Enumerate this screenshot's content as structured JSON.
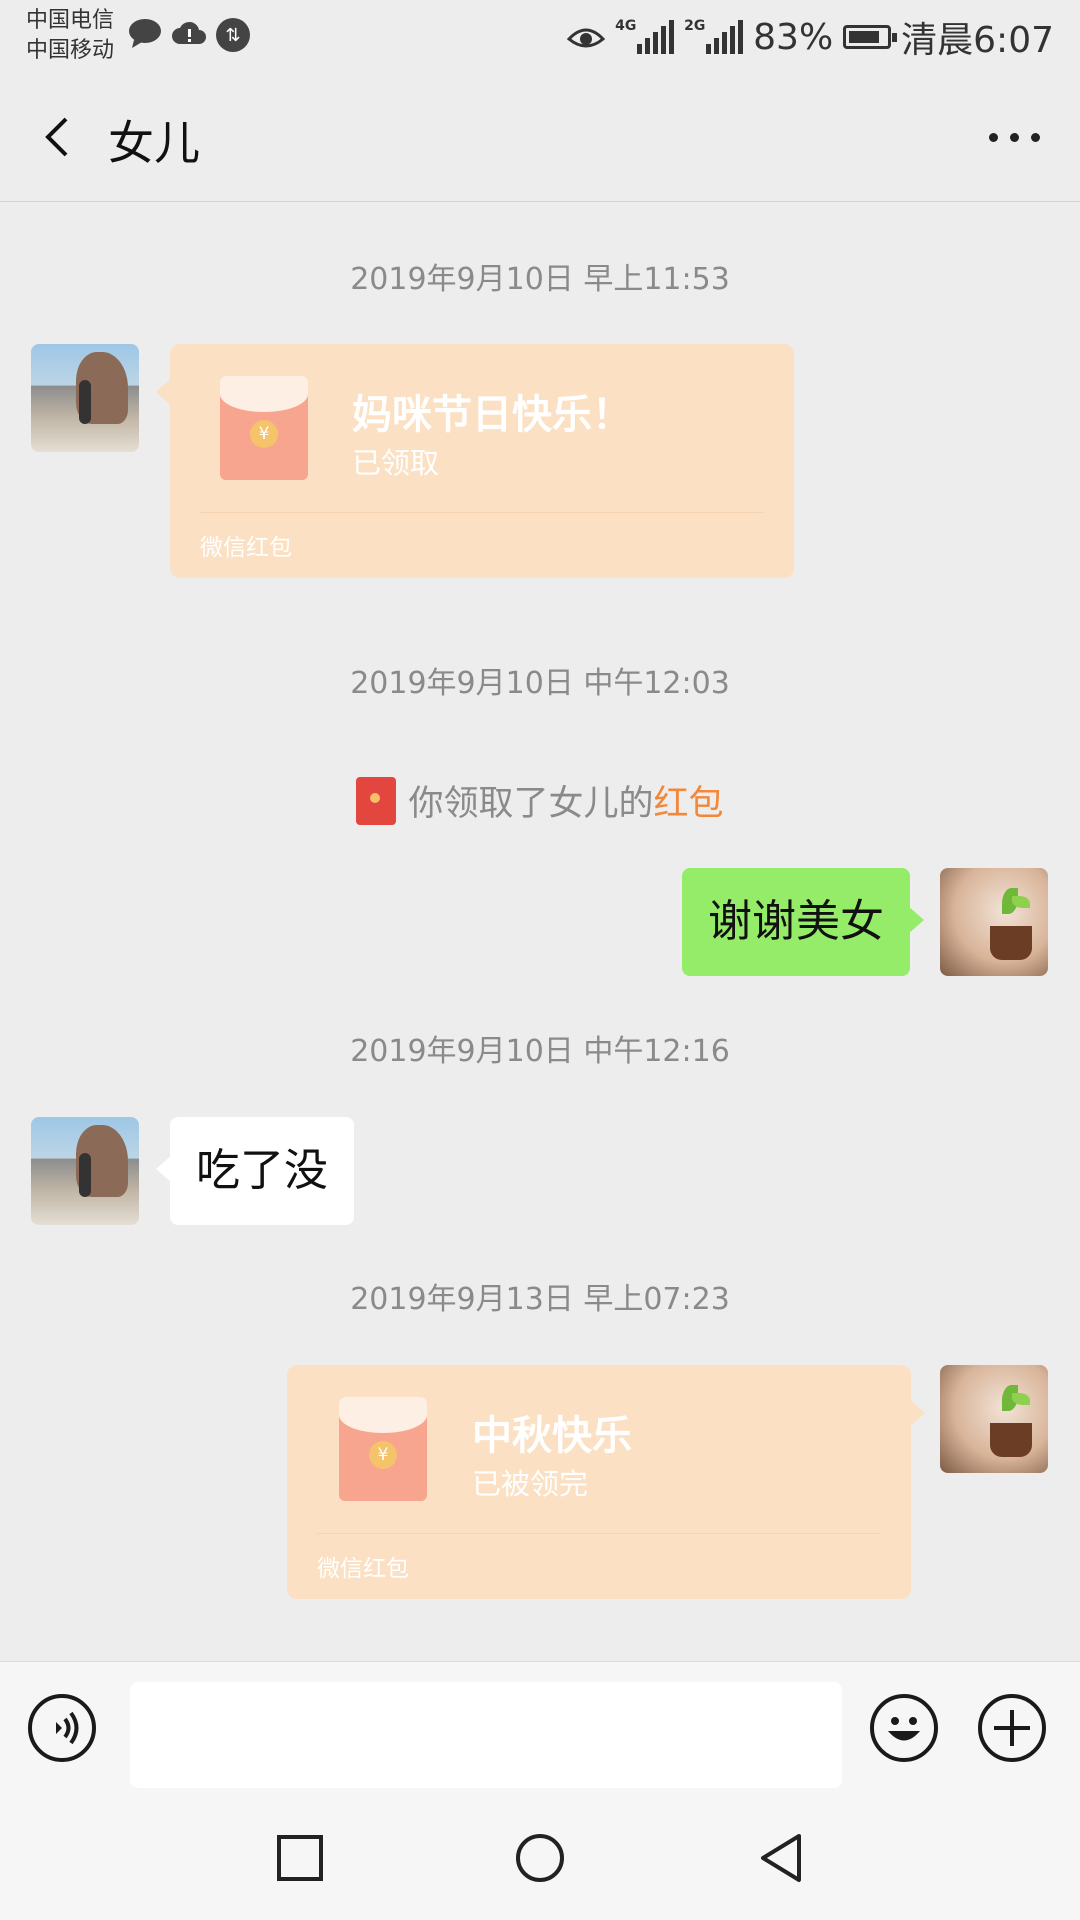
{
  "status_bar": {
    "carrier_1": "中国电信",
    "carrier_2": "中国移动",
    "network_1": "4G",
    "network_2": "2G",
    "battery": "83%",
    "time": "清晨6:07"
  },
  "header": {
    "title": "女儿",
    "back_icon": "chevron-left-icon",
    "more_icon": "more-horizontal-icon"
  },
  "messages": {
    "ts1": "2019年9月10日 早上11:53",
    "rp1": {
      "title": "妈咪节日快乐！",
      "status": "已领取",
      "footer": "微信红包"
    },
    "ts2": "2019年9月10日 中午12:03",
    "system": {
      "prefix": "你领取了女儿的",
      "link": "红包"
    },
    "msg_me_1": "谢谢美女",
    "ts3": "2019年9月10日 中午12:16",
    "msg_her_1": "吃了没",
    "ts4": "2019年9月13日 早上07:23",
    "rp2": {
      "title": "中秋快乐",
      "status": "已被领完",
      "footer": "微信红包"
    }
  },
  "input_bar": {
    "value": "",
    "voice_icon": "voice-icon",
    "emoji_icon": "emoji-icon",
    "plus_icon": "plus-icon"
  },
  "colors": {
    "background": "#ededed",
    "bubble_green": "#95ec69",
    "red_packet": "#fbe0c3",
    "link_orange": "#f1883a"
  }
}
